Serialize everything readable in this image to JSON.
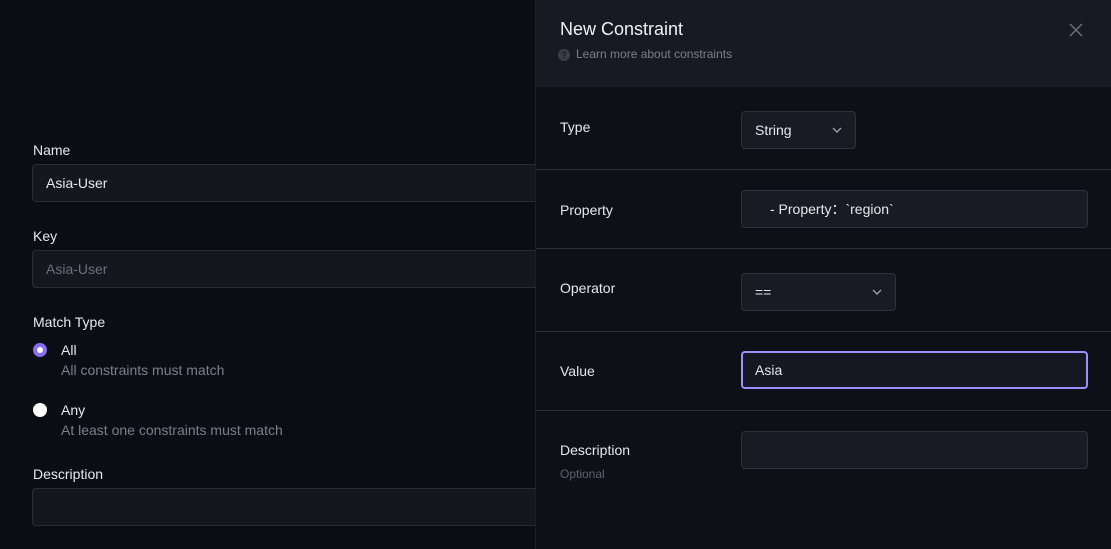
{
  "left_form": {
    "name_label": "Name",
    "name_value": "Asia-User",
    "key_label": "Key",
    "key_value": "Asia-User",
    "match_type_label": "Match Type",
    "options": [
      {
        "title": "All",
        "description": "All constraints must match",
        "checked": true
      },
      {
        "title": "Any",
        "description": "At least one constraints must match",
        "checked": false
      }
    ],
    "description_label": "Description",
    "description_value": ""
  },
  "panel": {
    "title": "New Constraint",
    "help_link": "Learn more about constraints",
    "help_icon": "question-circle-icon",
    "close_icon": "close-icon",
    "type": {
      "label": "Type",
      "value": "String"
    },
    "property": {
      "label": "Property",
      "value": "- Property：`region`"
    },
    "operator": {
      "label": "Operator",
      "value": "=="
    },
    "value": {
      "label": "Value",
      "value": "Asia"
    },
    "description": {
      "label": "Description",
      "sublabel": "Optional",
      "value": ""
    }
  },
  "colors": {
    "background": "#0b0d14",
    "panel_background": "#0e1017",
    "header_background": "#171a22",
    "accent": "#8c6cf0",
    "focus_border": "#a18cff"
  }
}
